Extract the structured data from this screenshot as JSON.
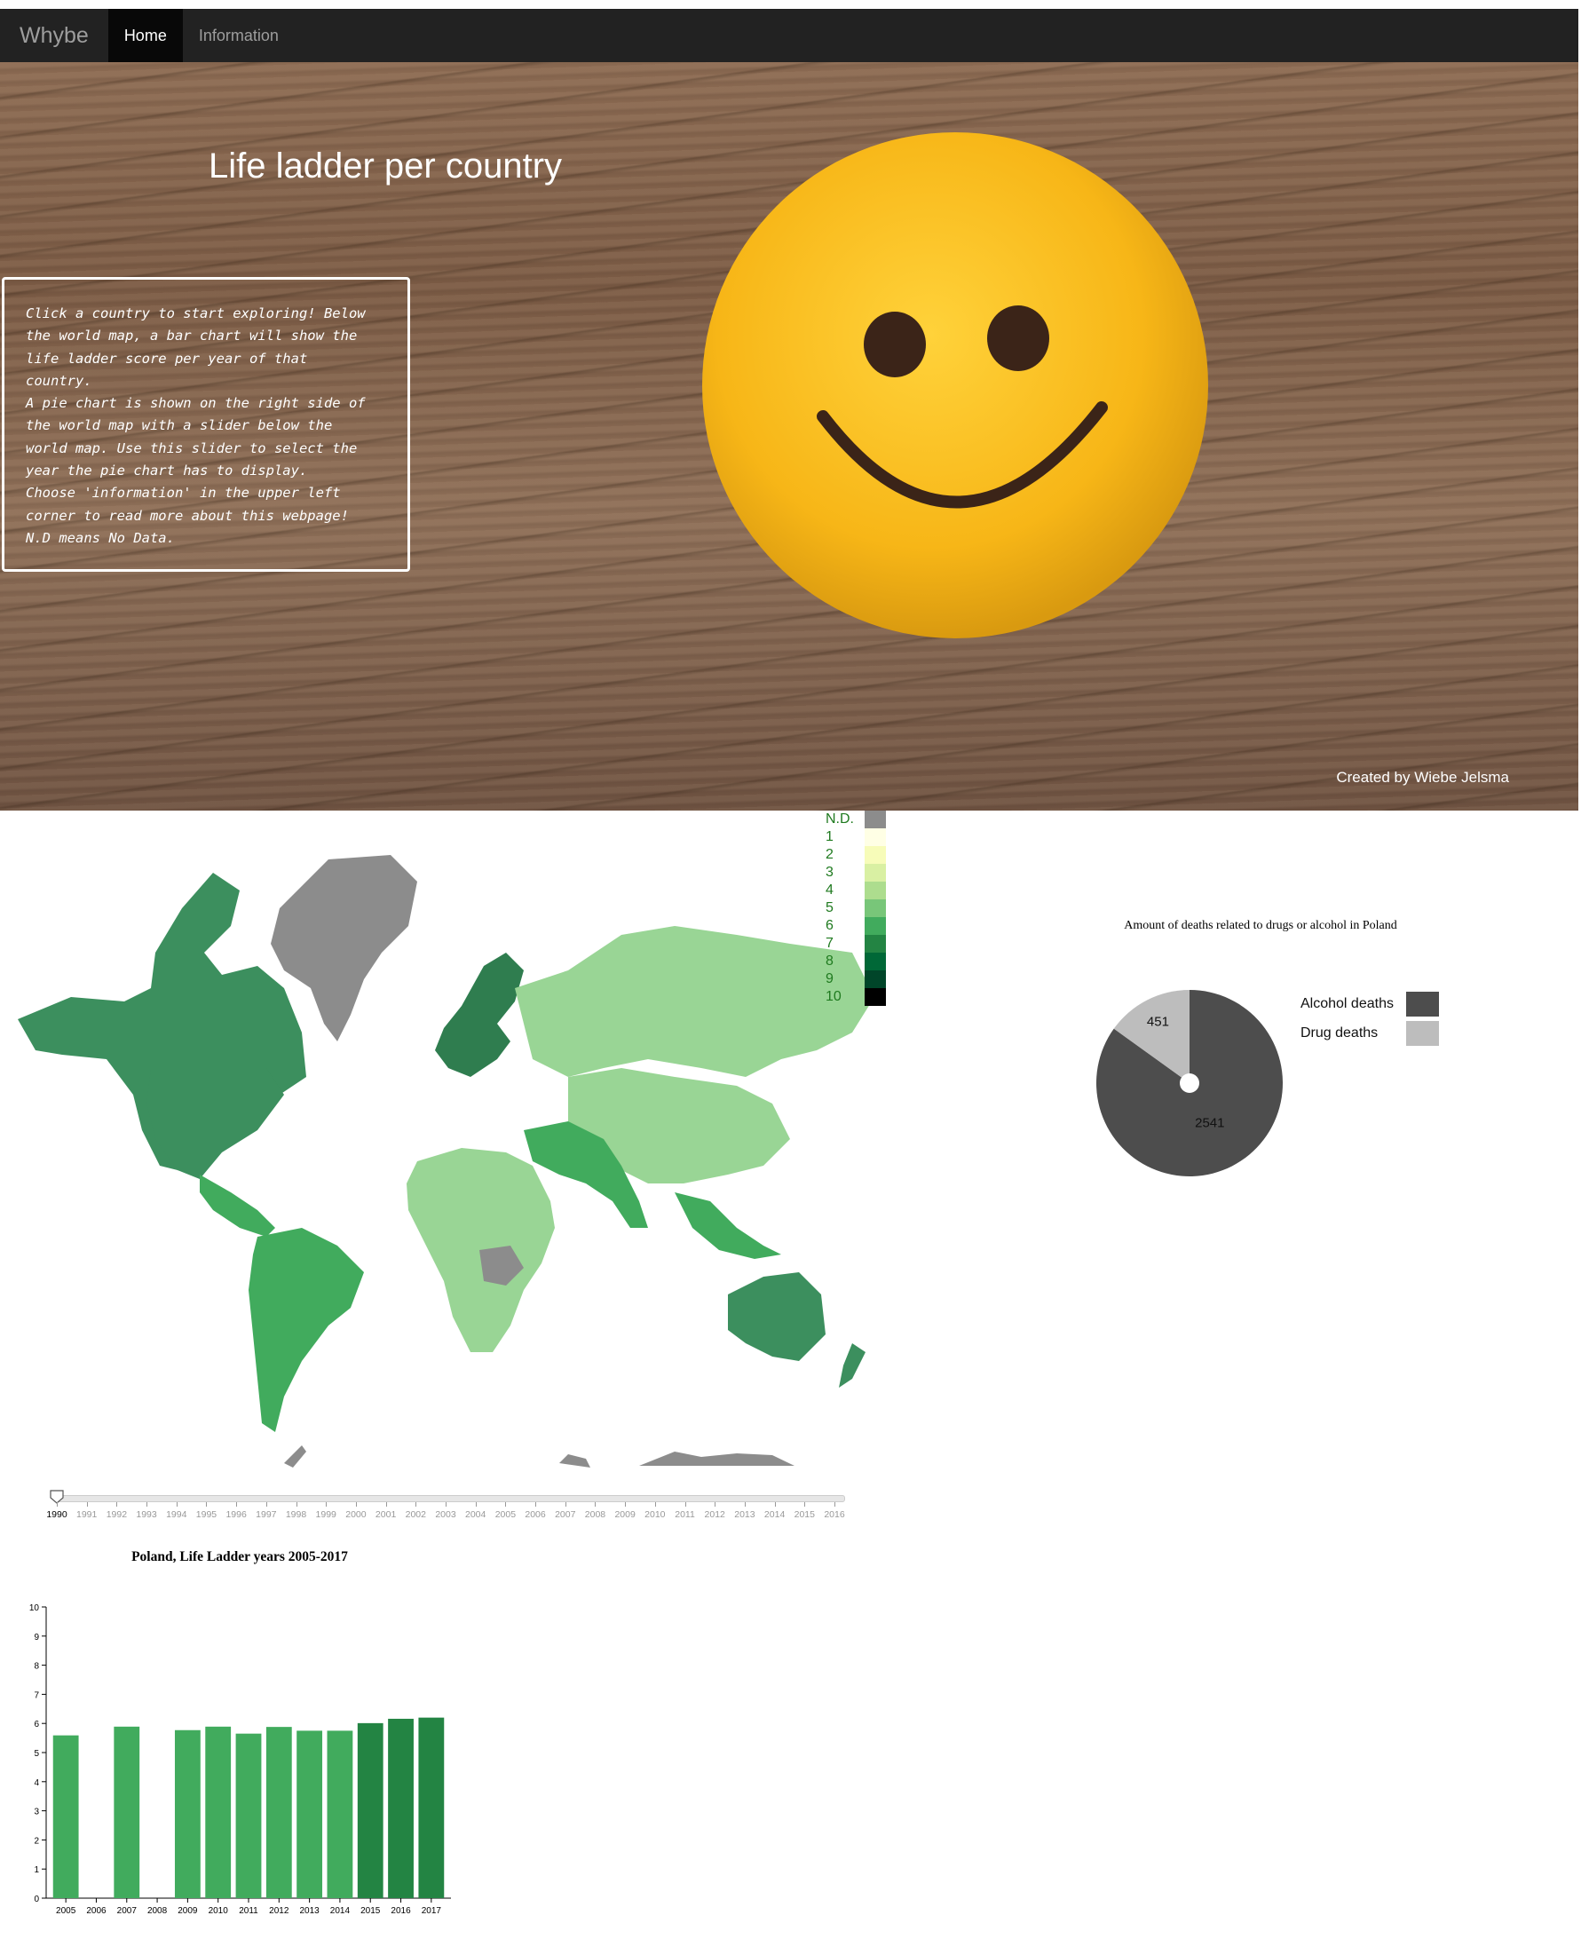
{
  "nav": {
    "brand": "Whybe",
    "items": [
      {
        "label": "Home",
        "active": true
      },
      {
        "label": "Information",
        "active": false
      }
    ]
  },
  "hero": {
    "title": "Life ladder per country",
    "intro": "Click a country to start exploring! Below\nthe world map, a bar chart will show the\nlife ladder score per year of that\ncountry.\nA pie chart is shown on the right side of\nthe world map with a slider below the\nworld map. Use this slider to select the\nyear the pie chart has to display.\nChoose 'information' in the upper left\ncorner to read more about this webpage!\nN.D means No Data.",
    "credit": "Created by Wiebe Jelsma"
  },
  "map": {
    "legend": [
      {
        "label": "N.D.",
        "color": "#8c8c8c"
      },
      {
        "label": "1",
        "color": "#ffffe5"
      },
      {
        "label": "2",
        "color": "#f7fcb9"
      },
      {
        "label": "3",
        "color": "#d9f0a3"
      },
      {
        "label": "4",
        "color": "#addd8e"
      },
      {
        "label": "5",
        "color": "#78c679"
      },
      {
        "label": "6",
        "color": "#41ab5d"
      },
      {
        "label": "7",
        "color": "#238443"
      },
      {
        "label": "8",
        "color": "#006837"
      },
      {
        "label": "9",
        "color": "#004529"
      },
      {
        "label": "10",
        "color": "#000000"
      }
    ]
  },
  "slider": {
    "years": [
      "1990",
      "1991",
      "1992",
      "1993",
      "1994",
      "1995",
      "1996",
      "1997",
      "1998",
      "1999",
      "2000",
      "2001",
      "2002",
      "2003",
      "2004",
      "2005",
      "2006",
      "2007",
      "2008",
      "2009",
      "2010",
      "2011",
      "2012",
      "2013",
      "2014",
      "2015",
      "2016"
    ],
    "selected": "1990"
  },
  "chart_data": [
    {
      "type": "pie",
      "title": "Amount of deaths related to drugs or alcohol in Poland",
      "slices": [
        {
          "label": "Alcohol deaths",
          "value": 2541,
          "color": "#4d4d4d"
        },
        {
          "label": "Drug deaths",
          "value": 451,
          "color": "#bdbdbd"
        }
      ]
    },
    {
      "type": "bar",
      "title": "Poland, Life Ladder years 2005-2017",
      "categories": [
        "2005",
        "2006",
        "2007",
        "2008",
        "2009",
        "2010",
        "2011",
        "2012",
        "2013",
        "2014",
        "2015",
        "2016",
        "2017"
      ],
      "values": [
        5.59,
        null,
        5.89,
        null,
        5.77,
        5.89,
        5.65,
        5.88,
        5.75,
        5.75,
        6.01,
        6.16,
        6.2
      ],
      "colors": [
        "#41ab5d",
        "#41ab5d",
        "#41ab5d",
        "#41ab5d",
        "#41ab5d",
        "#41ab5d",
        "#41ab5d",
        "#41ab5d",
        "#41ab5d",
        "#41ab5d",
        "#238443",
        "#238443",
        "#238443"
      ],
      "yticks": [
        "0",
        "1",
        "2",
        "3",
        "4",
        "5",
        "6",
        "7",
        "8",
        "9",
        "10"
      ],
      "ylim": [
        0,
        10
      ]
    }
  ]
}
